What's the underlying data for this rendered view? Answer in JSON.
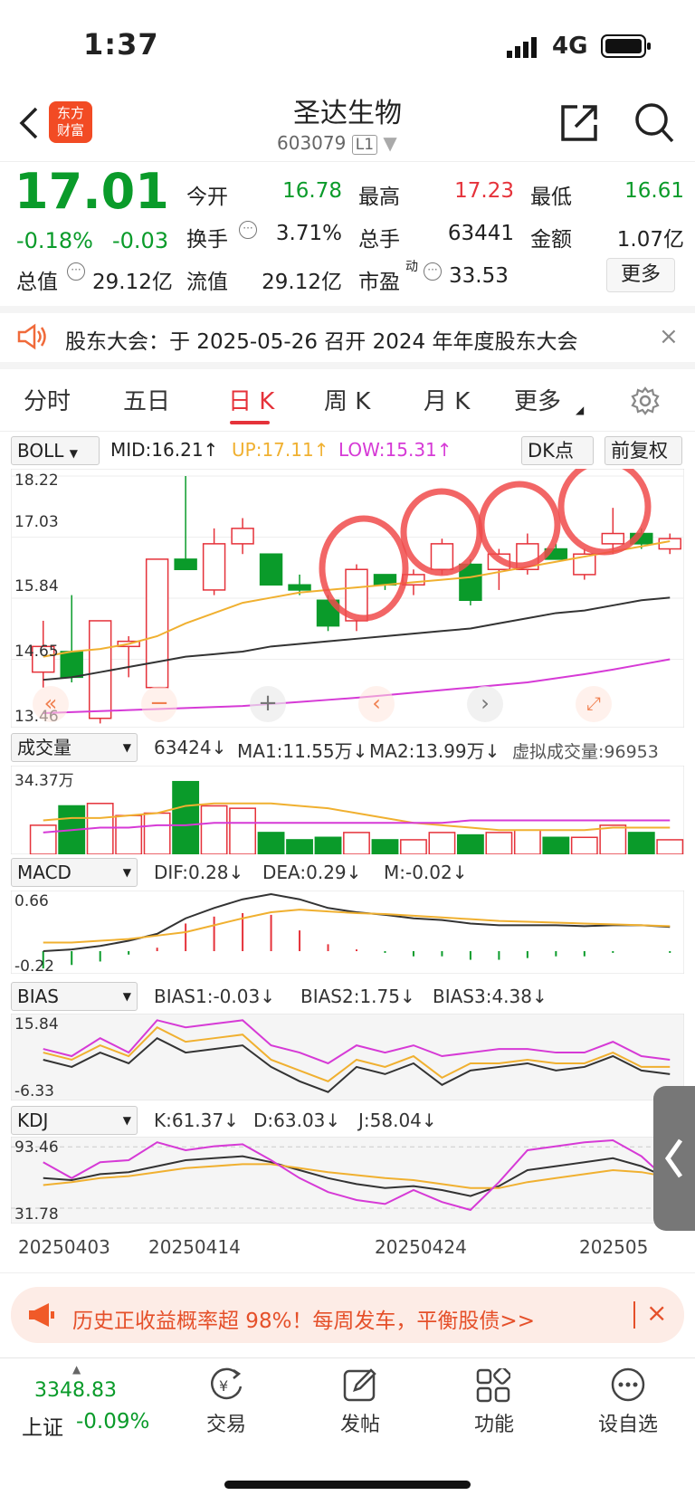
{
  "status": {
    "time": "1:37",
    "network": "4G"
  },
  "header": {
    "title": "圣达生物",
    "code": "603079",
    "level": "L1",
    "logo": "东方\n财富"
  },
  "quote": {
    "price": "17.01",
    "change_pct": "-0.18%",
    "change": "-0.03",
    "fields": [
      {
        "label": "今开",
        "value": "16.78",
        "color": "g"
      },
      {
        "label": "最高",
        "value": "17.23",
        "color": "r"
      },
      {
        "label": "最低",
        "value": "16.61",
        "color": "g"
      },
      {
        "label": "换手",
        "value": "3.71%"
      },
      {
        "label": "总手",
        "value": "63441"
      },
      {
        "label": "金额",
        "value": "1.07亿"
      },
      {
        "label": "总值",
        "value": "29.12亿"
      },
      {
        "label": "流值",
        "value": "29.12亿"
      },
      {
        "label": "市盈",
        "value": "33.53",
        "sup": "动"
      }
    ],
    "more": "更多"
  },
  "notice": {
    "text": "股东大会：于 2025-05-26 召开 2024 年年度股东大会"
  },
  "tabs": [
    "分时",
    "五日",
    "日 K",
    "周 K",
    "月 K",
    "更多"
  ],
  "active_tab": 2,
  "indicators": {
    "main": {
      "name": "BOLL",
      "mid": "MID:16.21↑",
      "up": "UP:17.11↑",
      "low": "LOW:15.31↑",
      "dk": "DK点",
      "fq": "前复权",
      "ymax": "18.22",
      "ymid1": "17.03",
      "ymid2": "15.84",
      "ymid3": "14.65",
      "ymin": "13.46"
    },
    "vol": {
      "name": "成交量",
      "v": "63424↓",
      "ma1": "MA1:11.55万↓",
      "ma2": "MA2:13.99万↓",
      "virtual": "虚拟成交量:96953",
      "ymax": "34.37万"
    },
    "macd": {
      "name": "MACD",
      "dif": "DIF:0.28↓",
      "dea": "DEA:0.29↓",
      "m": "M:-0.02↓",
      "ymax": "0.66",
      "ymin": "-0.22"
    },
    "bias": {
      "name": "BIAS",
      "b1": "BIAS1:-0.03↓",
      "b2": "BIAS2:1.75↓",
      "b3": "BIAS3:4.38↓",
      "ymax": "15.84",
      "ymin": "-6.33"
    },
    "kdj": {
      "name": "KDJ",
      "k": "K:61.37↓",
      "d": "D:63.03↓",
      "j": "J:58.04↓",
      "ymax": "93.46",
      "ymin": "31.78"
    }
  },
  "xaxis": [
    "20250403",
    "20250414",
    "20250424",
    "202505"
  ],
  "promo": {
    "text": "历史正收益概率超 98%！每周发车，平衡股债>>"
  },
  "bottom": {
    "index_value": "3348.83",
    "index_name": "上证",
    "index_change": "-0.09%",
    "items": [
      {
        "label": "交易",
        "icon": "trade-icon"
      },
      {
        "label": "发帖",
        "icon": "edit-icon"
      },
      {
        "label": "功能",
        "icon": "grid-icon"
      },
      {
        "label": "设自选",
        "icon": "more-icon"
      }
    ]
  },
  "chart_data": {
    "type": "candlestick",
    "ylim": [
      13.46,
      18.22
    ],
    "candles": [
      [
        14.4,
        14.9,
        14.1,
        15.4
      ],
      [
        14.8,
        14.3,
        14.2,
        15.9
      ],
      [
        13.5,
        15.4,
        13.4,
        15.4
      ],
      [
        14.9,
        15.0,
        14.3,
        15.1
      ],
      [
        14.1,
        16.6,
        14.1,
        16.6
      ],
      [
        16.6,
        16.4,
        16.4,
        18.22
      ],
      [
        16.0,
        16.9,
        15.9,
        17.2
      ],
      [
        16.9,
        17.2,
        16.7,
        17.4
      ],
      [
        16.7,
        16.1,
        16.1,
        16.7
      ],
      [
        16.1,
        16.0,
        15.9,
        16.3
      ],
      [
        15.8,
        15.3,
        15.2,
        15.9
      ],
      [
        15.4,
        16.4,
        15.2,
        16.5
      ],
      [
        16.3,
        16.1,
        16.0,
        16.3
      ],
      [
        16.1,
        16.3,
        15.9,
        16.4
      ],
      [
        16.4,
        16.9,
        16.3,
        17.0
      ],
      [
        16.5,
        15.8,
        15.7,
        16.6
      ],
      [
        16.4,
        16.7,
        16.0,
        16.8
      ],
      [
        16.4,
        16.9,
        16.3,
        17.1
      ],
      [
        16.8,
        16.6,
        16.6,
        16.9
      ],
      [
        16.3,
        16.7,
        16.2,
        16.8
      ],
      [
        16.9,
        17.1,
        16.7,
        17.6
      ],
      [
        17.1,
        16.9,
        16.8,
        17.2
      ],
      [
        16.8,
        17.0,
        16.7,
        17.1
      ]
    ],
    "mid": [
      14.7,
      14.8,
      14.85,
      14.95,
      15.1,
      15.35,
      15.55,
      15.75,
      15.85,
      15.95,
      16.0,
      16.05,
      16.1,
      16.15,
      16.2,
      16.25,
      16.35,
      16.45,
      16.55,
      16.65,
      16.75,
      16.85,
      16.95
    ],
    "lower": [
      14.25,
      14.3,
      14.4,
      14.5,
      14.6,
      14.7,
      14.75,
      14.8,
      14.9,
      14.95,
      15.0,
      15.05,
      15.1,
      15.15,
      15.2,
      15.25,
      15.35,
      15.45,
      15.55,
      15.6,
      15.7,
      15.8,
      15.85
    ],
    "upper": [
      13.6,
      13.62,
      13.64,
      13.66,
      13.68,
      13.7,
      13.72,
      13.74,
      13.78,
      13.82,
      13.86,
      13.9,
      13.95,
      14.0,
      14.05,
      14.1,
      14.15,
      14.2,
      14.28,
      14.36,
      14.45,
      14.55,
      14.65
    ],
    "volume": [
      12,
      20,
      21,
      16,
      17,
      30,
      20,
      19,
      9,
      6,
      7,
      9,
      6,
      6,
      9,
      8,
      9,
      10,
      7,
      7,
      12,
      9,
      6
    ]
  }
}
